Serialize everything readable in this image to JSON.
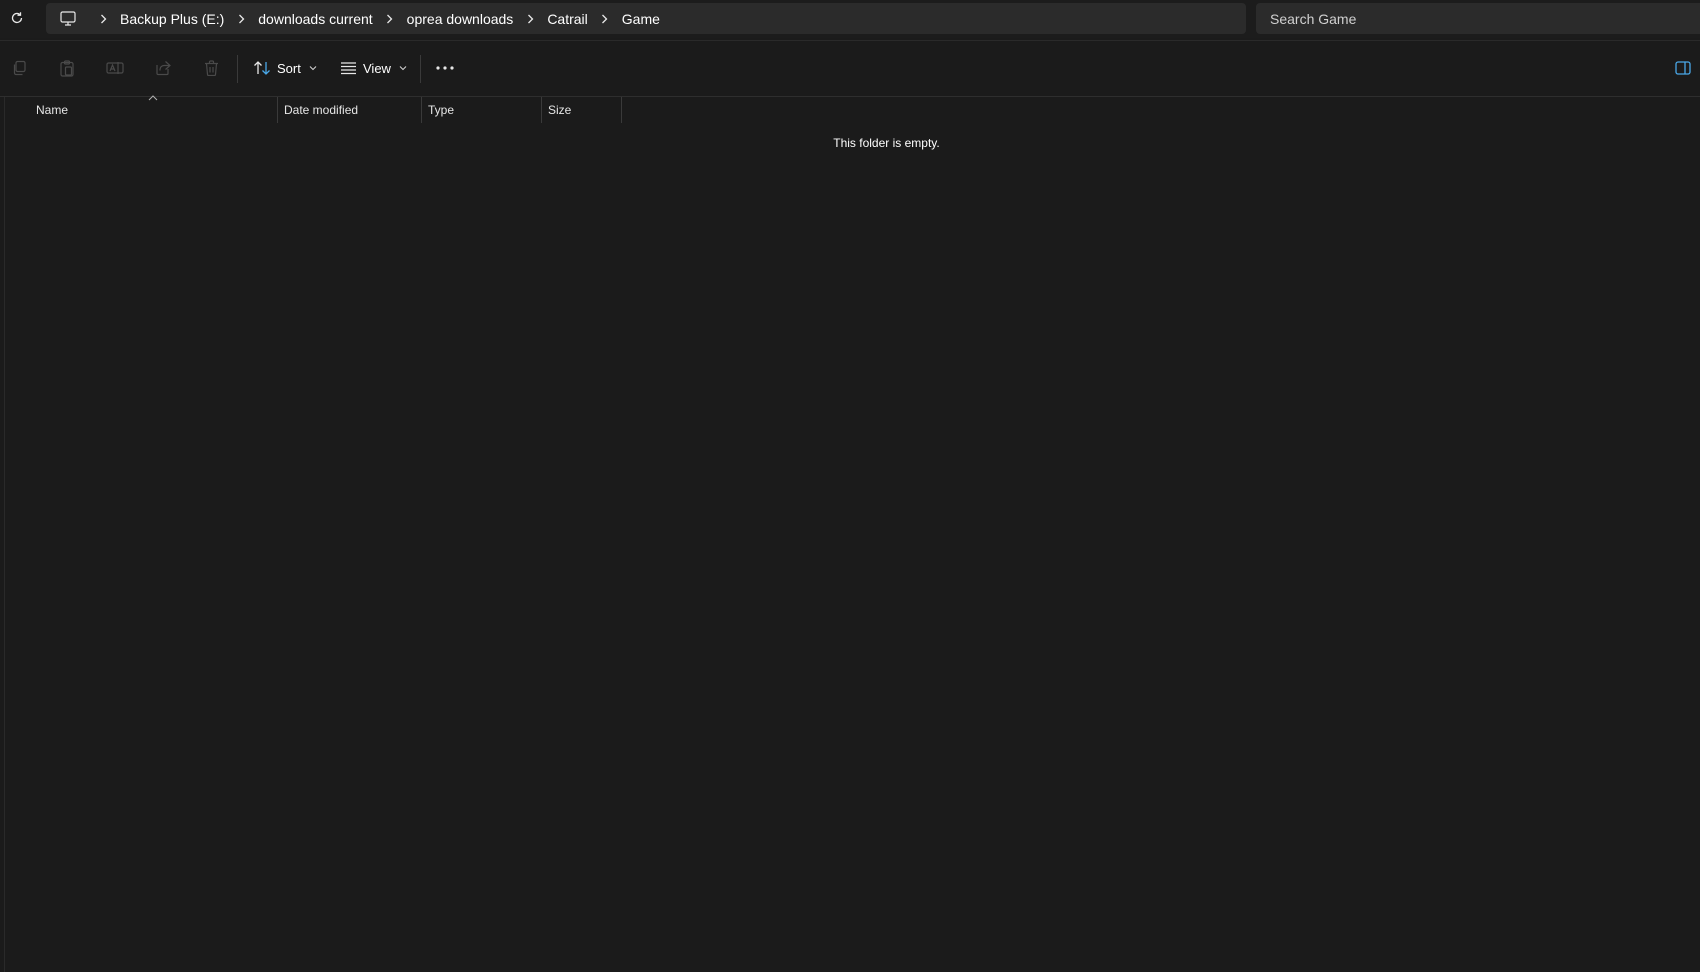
{
  "breadcrumb": {
    "root_icon": "computer-icon",
    "items": [
      "Backup Plus (E:)",
      "downloads current",
      "oprea downloads",
      "Catrail",
      "Game"
    ]
  },
  "search": {
    "placeholder": "Search Game"
  },
  "toolbar": {
    "icons": [
      "copy-icon",
      "paste-icon",
      "rename-icon",
      "share-icon",
      "delete-icon"
    ],
    "sort_label": "Sort",
    "view_label": "View",
    "more_icon": "more-options-icon",
    "details_pane_icon": "details-pane-icon"
  },
  "columns": [
    "Name",
    "Date modified",
    "Type",
    "Size"
  ],
  "empty_message": "This folder is empty.",
  "colors": {
    "background": "#1b1b1b",
    "field": "#2b2b2b",
    "accent": "#4aa8e8",
    "text": "#ffffff"
  }
}
